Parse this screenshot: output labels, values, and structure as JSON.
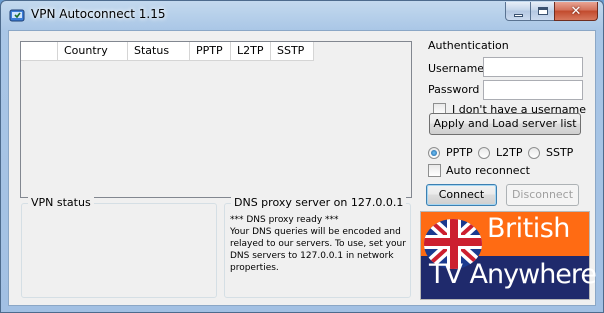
{
  "window": {
    "title": "VPN Autoconnect 1.15",
    "icon": "shield-icon"
  },
  "server_list": {
    "columns": [
      "",
      "Country",
      "Status",
      "PPTP",
      "L2TP",
      "SSTP"
    ],
    "rows": []
  },
  "auth": {
    "group_label": "Authentication",
    "username_label": "Username",
    "username_value": "",
    "password_label": "Password",
    "password_value": "",
    "no_username_label": "I don't have a username",
    "no_username_checked": false,
    "apply_label": "Apply and Load server list"
  },
  "protocol": {
    "options": [
      {
        "label": "PPTP",
        "checked": true
      },
      {
        "label": "L2TP",
        "checked": false
      },
      {
        "label": "SSTP",
        "checked": false
      }
    ],
    "auto_reconnect_label": "Auto reconnect",
    "auto_reconnect_checked": false
  },
  "actions": {
    "connect_label": "Connect",
    "disconnect_label": "Disconnect"
  },
  "vpn_status": {
    "group_label": "VPN status",
    "text": ""
  },
  "dns_proxy": {
    "group_label": "DNS proxy server on 127.0.0.1",
    "text": "*** DNS proxy ready ***\nYour DNS queries will be encoded and relayed to our servers. To use, set your DNS servers to 127.0.0.1 in network properties."
  },
  "banner": {
    "line1": "British",
    "line2": "TV Anywhere",
    "colors": {
      "top": "#ff6b13",
      "bottom": "#1f2a6c"
    }
  }
}
